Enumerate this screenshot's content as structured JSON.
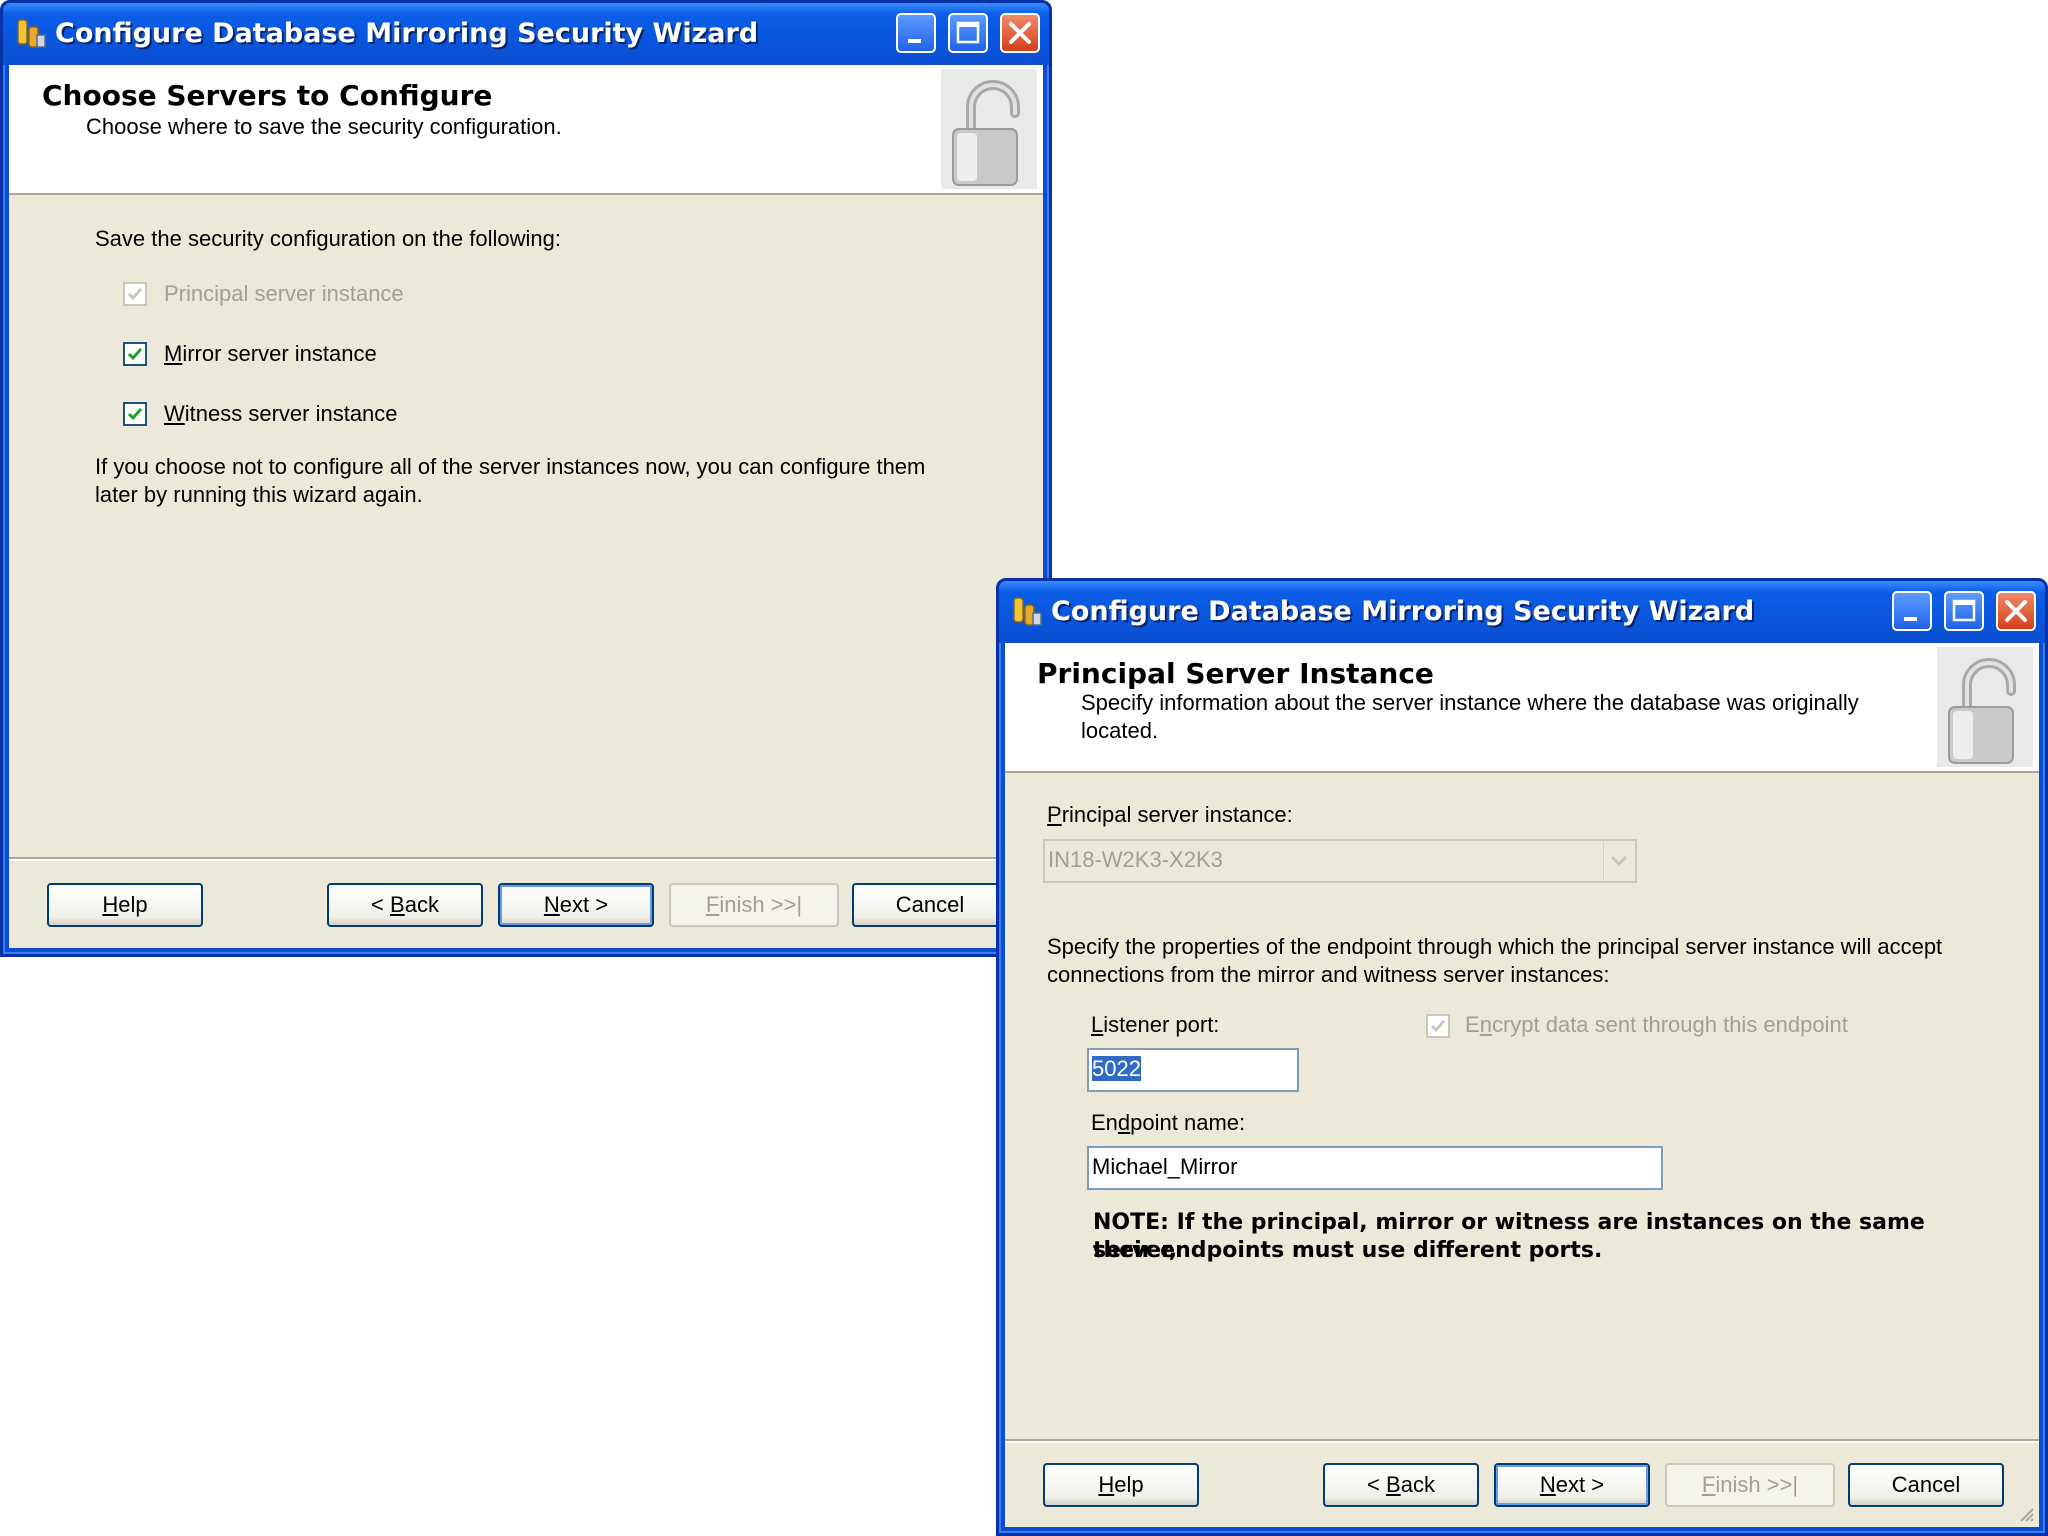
{
  "window1": {
    "title": "Configure Database Mirroring Security Wizard",
    "header_title": "Choose Servers to Configure",
    "header_subtitle": "Choose where to save the security configuration.",
    "intro": "Save the security configuration on the following:",
    "checkboxes": [
      {
        "label": "Principal server instance",
        "checked": true,
        "enabled": false
      },
      {
        "label": "Mirror server instance",
        "checked": true,
        "enabled": true,
        "mnemonic": "M"
      },
      {
        "label": "Witness server instance",
        "checked": true,
        "enabled": true,
        "mnemonic": "W"
      }
    ],
    "info_line1": "If you choose not to configure all of the server instances now, you can configure them",
    "info_line2": "later by running this wizard again.",
    "buttons": {
      "help": "Help",
      "back": "< Back",
      "next": "Next >",
      "finish": "Finish >>|",
      "cancel": "Cancel"
    }
  },
  "window2": {
    "title": "Configure Database Mirroring Security Wizard",
    "header_title": "Principal Server Instance",
    "header_subtitle_line1": "Specify information about the server instance where the database was originally",
    "header_subtitle_line2": "located.",
    "principal_label": "Principal server instance:",
    "principal_value": "IN18-W2K3-X2K3",
    "endpoint_desc_line1": "Specify the properties of the endpoint through which the principal server instance will accept",
    "endpoint_desc_line2": "connections from the mirror and witness server instances:",
    "listener_label": "Listener port:",
    "listener_value": "5022",
    "encrypt_label": "Encrypt data sent through this endpoint",
    "encrypt_checked": true,
    "endpoint_name_label": "Endpoint name:",
    "endpoint_name_value": "Michael_Mirror",
    "note_line1": "NOTE: If the principal, mirror or witness are instances on the same server,",
    "note_line2": "their endpoints must use different ports.",
    "buttons": {
      "help": "Help",
      "back": "< Back",
      "next": "Next >",
      "finish": "Finish >>|",
      "cancel": "Cancel"
    }
  },
  "colors": {
    "titlebar": "#0a55dd",
    "dialog_bg": "#ece9d8",
    "selection": "#316ac5",
    "checkmark": "#21a121"
  },
  "icons": [
    "app-icon",
    "minimize-icon",
    "maximize-icon",
    "close-icon",
    "padlock-icon",
    "checkmark-icon",
    "dropdown-arrow-icon",
    "resize-grip-icon"
  ]
}
